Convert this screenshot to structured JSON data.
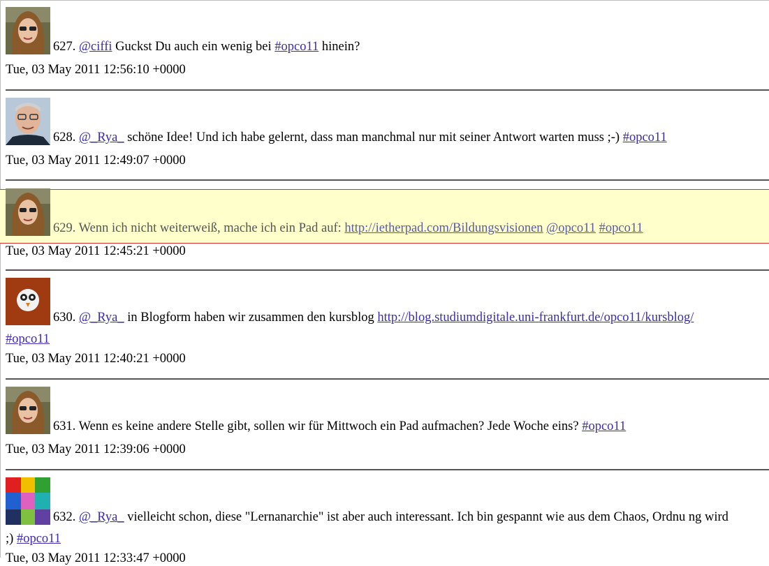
{
  "tweets": [
    {
      "avatar": "avatar-woman-sunglasses",
      "number": "627.",
      "parts": [
        {
          "type": "link",
          "text": "@ciffi"
        },
        {
          "type": "text",
          "text": " Guckst Du auch ein wenig bei "
        },
        {
          "type": "link",
          "text": "#opco11"
        },
        {
          "type": "text",
          "text": " hinein?"
        }
      ],
      "timestamp": "Tue, 03 May 2011 12:56:10 +0000"
    },
    {
      "avatar": "avatar-man-glasses",
      "number": "628.",
      "parts": [
        {
          "type": "link",
          "text": "@_Rya_"
        },
        {
          "type": "text",
          "text": " schöne Idee! Und ich habe gelernt, dass man manchmal nur mit seiner Antwort warten muss ;-) "
        },
        {
          "type": "link",
          "text": "#opco11"
        }
      ],
      "timestamp": "Tue, 03 May 2011 12:49:07 +0000"
    },
    {
      "avatar": "avatar-woman-sunglasses",
      "number": "629.",
      "parts": [
        {
          "type": "text",
          "text": " Wenn ich nicht weiterweiß, mache ich ein Pad auf: "
        },
        {
          "type": "link",
          "text": "http://ietherpad.com/Bildungsvisionen"
        },
        {
          "type": "text",
          "text": " "
        },
        {
          "type": "link",
          "text": "@opco11"
        },
        {
          "type": "text",
          "text": " "
        },
        {
          "type": "link",
          "text": "#opco11"
        }
      ],
      "timestamp": "Tue, 03 May 2011 12:45:21 +0000",
      "highlighted": true
    },
    {
      "avatar": "avatar-owl-logo",
      "number": "630.",
      "parts": [
        {
          "type": "link",
          "text": "@_Rya_"
        },
        {
          "type": "text",
          "text": " in Blogform haben wir zusammen den kursblog "
        },
        {
          "type": "link",
          "text": "http://blog.studiumdigitale.uni-frankfurt.de/opco11/kursblog/"
        }
      ],
      "continuation": [
        {
          "type": "link",
          "text": "#opco11"
        }
      ],
      "timestamp": "Tue, 03 May 2011 12:40:21 +0000"
    },
    {
      "avatar": "avatar-woman-sunglasses",
      "number": "631.",
      "parts": [
        {
          "type": "text",
          "text": " Wenn es keine andere Stelle gibt, sollen wir für Mittwoch ein Pad aufmachen? Jede Woche eins? "
        },
        {
          "type": "link",
          "text": "#opco11"
        }
      ],
      "timestamp": "Tue, 03 May 2011 12:39:06 +0000"
    },
    {
      "avatar": "avatar-colorful-collage",
      "number": "632.",
      "parts": [
        {
          "type": "link",
          "text": "@_Rya_"
        },
        {
          "type": "text",
          "text": " vielleicht schon, diese \"Lernanarchie\" ist aber auch interessant. Ich bin gespannt wie aus dem Chaos, Ordnu ng wird"
        }
      ],
      "continuation": [
        {
          "type": "text",
          "text": ";) "
        },
        {
          "type": "link",
          "text": "#opco11"
        }
      ],
      "timestamp": "Tue, 03 May 2011 12:33:47 +0000"
    }
  ]
}
